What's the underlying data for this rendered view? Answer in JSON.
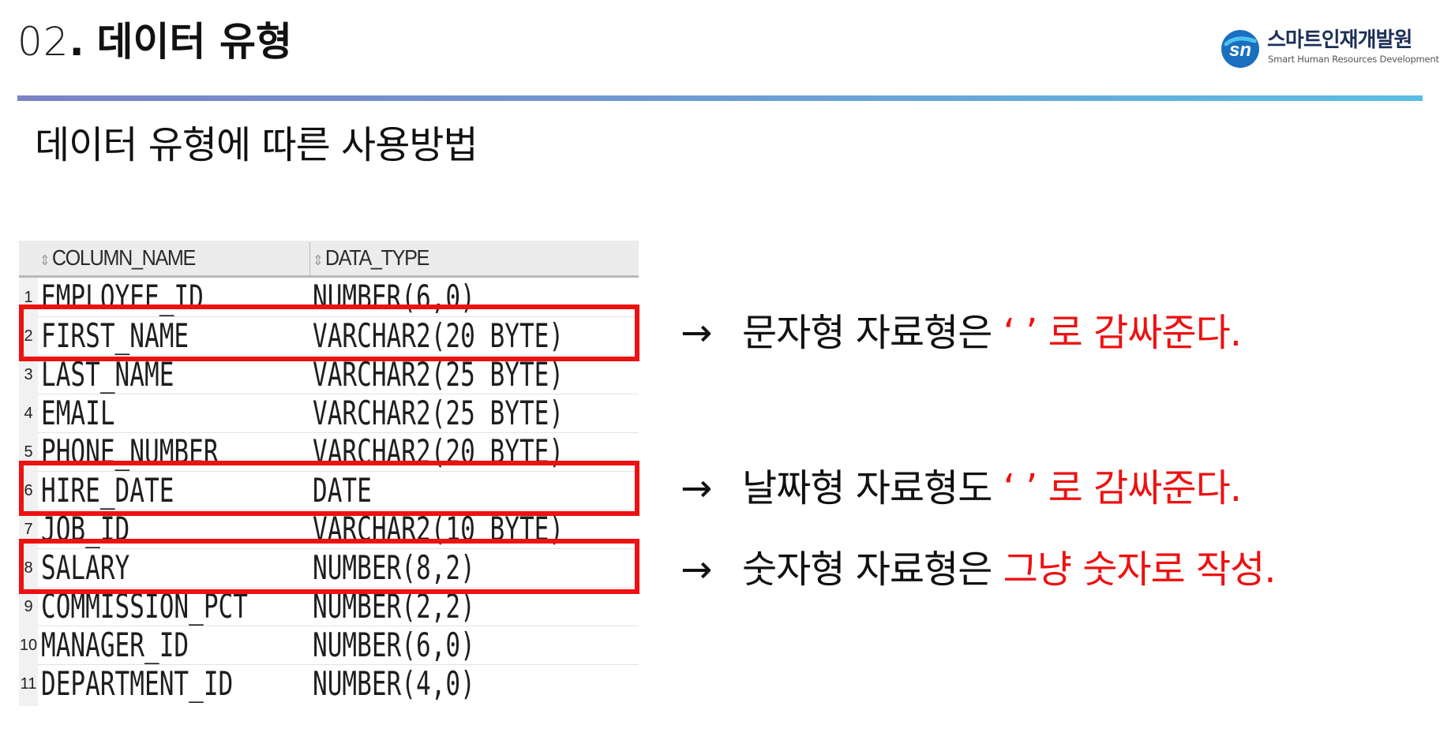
{
  "header": {
    "number": "02",
    "dot": ".",
    "title": "데이터 유형"
  },
  "logo": {
    "name_ko": "스마트인재개발원",
    "name_en": "Smart Human Resources Development"
  },
  "subtitle": "데이터 유형에 따른 사용방법",
  "table": {
    "columns": [
      "COLUMN_NAME",
      "DATA_TYPE"
    ],
    "rows": [
      {
        "n": "1",
        "name": "EMPLOYEE_ID",
        "type": "NUMBER(6,0)"
      },
      {
        "n": "2",
        "name": "FIRST_NAME",
        "type": "VARCHAR2(20 BYTE)"
      },
      {
        "n": "3",
        "name": "LAST_NAME",
        "type": "VARCHAR2(25 BYTE)"
      },
      {
        "n": "4",
        "name": "EMAIL",
        "type": "VARCHAR2(25 BYTE)"
      },
      {
        "n": "5",
        "name": "PHONE_NUMBER",
        "type": "VARCHAR2(20 BYTE)"
      },
      {
        "n": "6",
        "name": "HIRE_DATE",
        "type": "DATE"
      },
      {
        "n": "7",
        "name": "JOB_ID",
        "type": "VARCHAR2(10 BYTE)"
      },
      {
        "n": "8",
        "name": "SALARY",
        "type": "NUMBER(8,2)"
      },
      {
        "n": "9",
        "name": "COMMISSION_PCT",
        "type": "NUMBER(2,2)"
      },
      {
        "n": "10",
        "name": "MANAGER_ID",
        "type": "NUMBER(6,0)"
      },
      {
        "n": "11",
        "name": "DEPARTMENT_ID",
        "type": "NUMBER(4,0)"
      }
    ]
  },
  "notes": [
    {
      "arrow": "→",
      "black": "문자형 자료형은 ",
      "red": "‘ ’ 로 감싸준다."
    },
    {
      "arrow": "→",
      "black": "날짜형 자료형도 ",
      "red": "‘ ’ 로 감싸준다."
    },
    {
      "arrow": "→",
      "black": "숫자형 자료형은 ",
      "red": "그냥 숫자로 작성."
    }
  ],
  "colors": {
    "highlight": "#ee1111",
    "divider_start": "#7b83c6",
    "divider_end": "#5cbde6",
    "logo_blue": "#1a6fc0"
  },
  "icons": [
    "sort-icon",
    "arrow-right-icon",
    "logo-mark-icon"
  ]
}
